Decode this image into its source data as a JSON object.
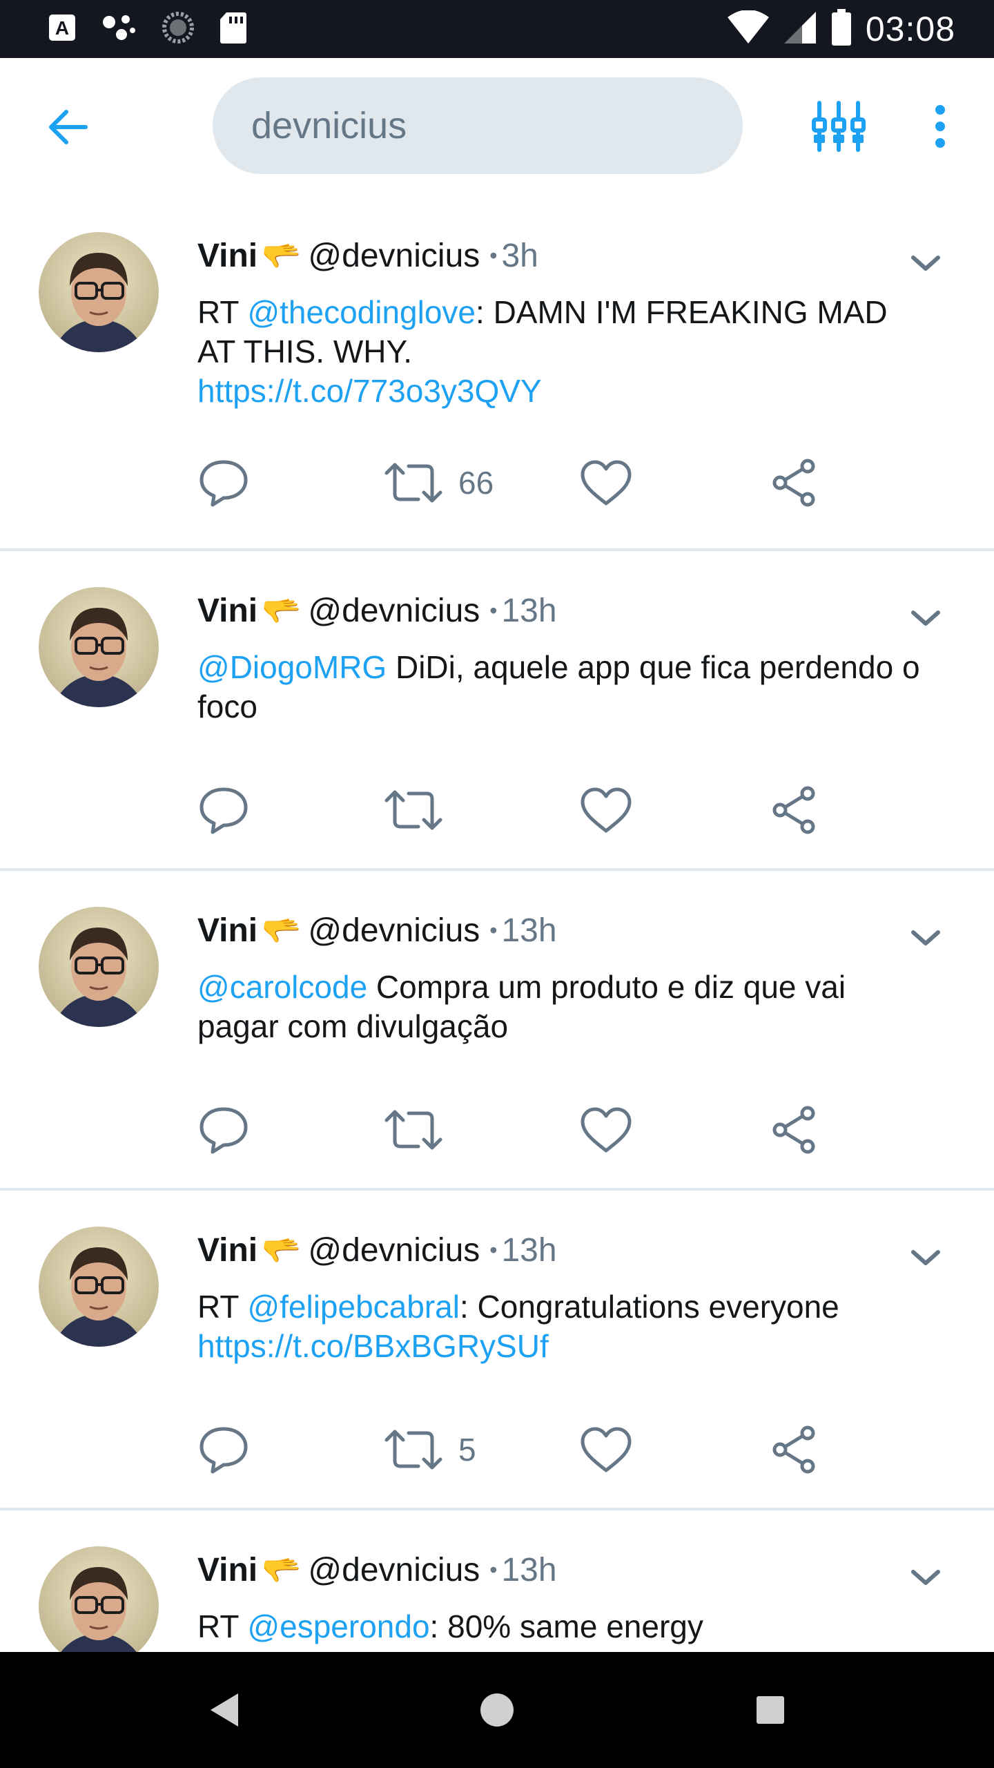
{
  "status_bar": {
    "time": "03:08",
    "left_icons": [
      "keyboard-a-icon",
      "assistant-dots-icon",
      "sync-circle-icon",
      "sd-card-icon"
    ],
    "right_icons": [
      "wifi-icon",
      "cellular-signal-icon",
      "battery-icon"
    ]
  },
  "app_bar": {
    "search_query": "devnicius",
    "back_icon": "arrow-left-icon",
    "filter_icon": "filter-sliders-icon",
    "more_icon": "vertical-dots-icon"
  },
  "tweets": [
    {
      "name": "Vini",
      "emoji": "🫳",
      "handle": "@devnicius",
      "dot": "•",
      "time": "3h",
      "text_parts": [
        {
          "type": "plain",
          "text": "RT "
        },
        {
          "type": "mention",
          "text": "@thecodinglove"
        },
        {
          "type": "plain",
          "text": ": DAMN I'M FREAKING MAD AT THIS. WHY. "
        },
        {
          "type": "link",
          "text": "https://t.co/773o3y3QVY"
        }
      ],
      "retweet_count": "66"
    },
    {
      "name": "Vini",
      "emoji": "🫳",
      "handle": "@devnicius",
      "dot": "•",
      "time": "13h",
      "text_parts": [
        {
          "type": "mention",
          "text": "@DiogoMRG"
        },
        {
          "type": "plain",
          "text": " DiDi, aquele app que fica perdendo o foco"
        }
      ],
      "retweet_count": ""
    },
    {
      "name": "Vini",
      "emoji": "🫳",
      "handle": "@devnicius",
      "dot": "•",
      "time": "13h",
      "text_parts": [
        {
          "type": "mention",
          "text": "@carolcode"
        },
        {
          "type": "plain",
          "text": " Compra um produto e diz que vai pagar com divulgação"
        }
      ],
      "retweet_count": ""
    },
    {
      "name": "Vini",
      "emoji": "🫳",
      "handle": "@devnicius",
      "dot": "•",
      "time": "13h",
      "text_parts": [
        {
          "type": "plain",
          "text": "RT "
        },
        {
          "type": "mention",
          "text": "@felipebcabral"
        },
        {
          "type": "plain",
          "text": ": Congratulations everyone "
        },
        {
          "type": "link",
          "text": "https://t.co/BBxBGRySUf"
        }
      ],
      "retweet_count": "5"
    },
    {
      "name": "Vini",
      "emoji": "🫳",
      "handle": "@devnicius",
      "dot": "•",
      "time": "13h",
      "text_parts": [
        {
          "type": "plain",
          "text": "RT "
        },
        {
          "type": "mention",
          "text": "@esperondo"
        },
        {
          "type": "plain",
          "text": ": 80% same energy"
        }
      ],
      "retweet_count": ""
    }
  ],
  "nav_bar": {
    "buttons": [
      "back-triangle-icon",
      "home-circle-icon",
      "recents-square-icon"
    ]
  },
  "colors": {
    "accent": "#1da1f2",
    "secondary_text": "#657786",
    "divider": "#e1e8ed",
    "status_bar_bg": "#14171f"
  }
}
